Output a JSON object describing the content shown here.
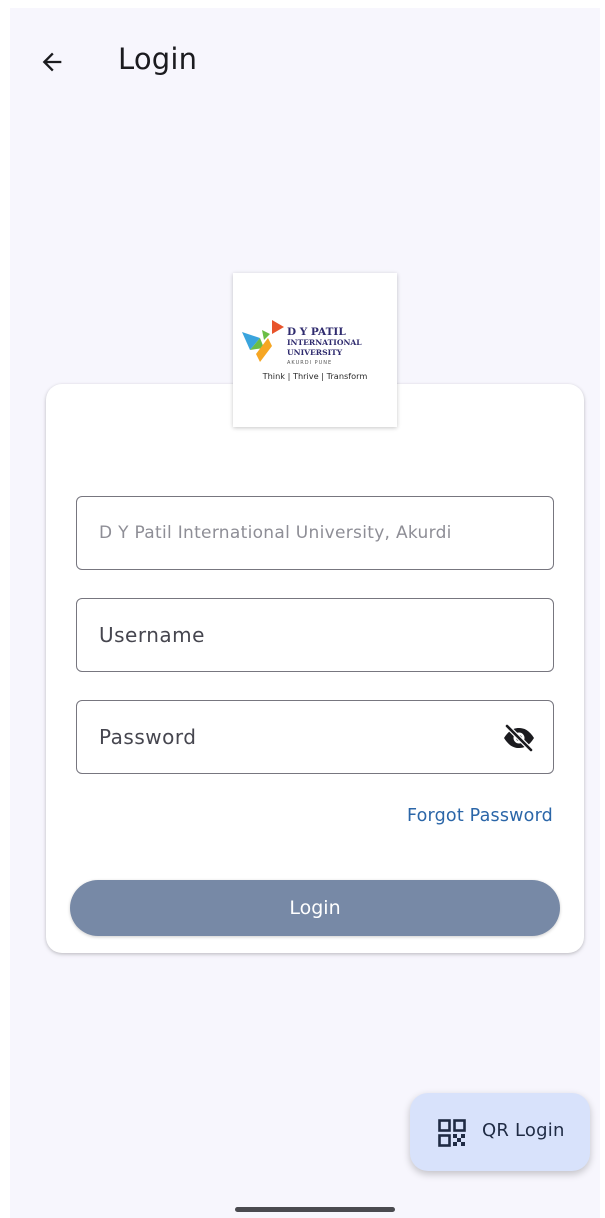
{
  "appbar": {
    "title": "Login",
    "back_icon": "arrow-back-icon"
  },
  "logo": {
    "line1": "D Y PATIL",
    "line2": "INTERNATIONAL",
    "line3": "UNIVERSITY",
    "line4": "AKURDI PUNE",
    "tagline": "Think | Thrive | Transform",
    "colors": [
      "#3aa4dd",
      "#6bbd45",
      "#f6a623",
      "#e8542c",
      "#2f2b6e"
    ]
  },
  "form": {
    "organization": {
      "value": "D Y Patil International University, Akurdi"
    },
    "username": {
      "placeholder": "Username"
    },
    "password": {
      "placeholder": "Password",
      "toggle_icon": "eye-off-icon"
    },
    "forgot_label": "Forgot Password",
    "login_label": "Login"
  },
  "fab": {
    "label": "QR Login",
    "icon": "qr-code-icon"
  },
  "colors": {
    "background": "#f7f6fd",
    "login_button": "#7789a6",
    "link": "#2b66a8",
    "fab_background": "#d8e2fb"
  }
}
